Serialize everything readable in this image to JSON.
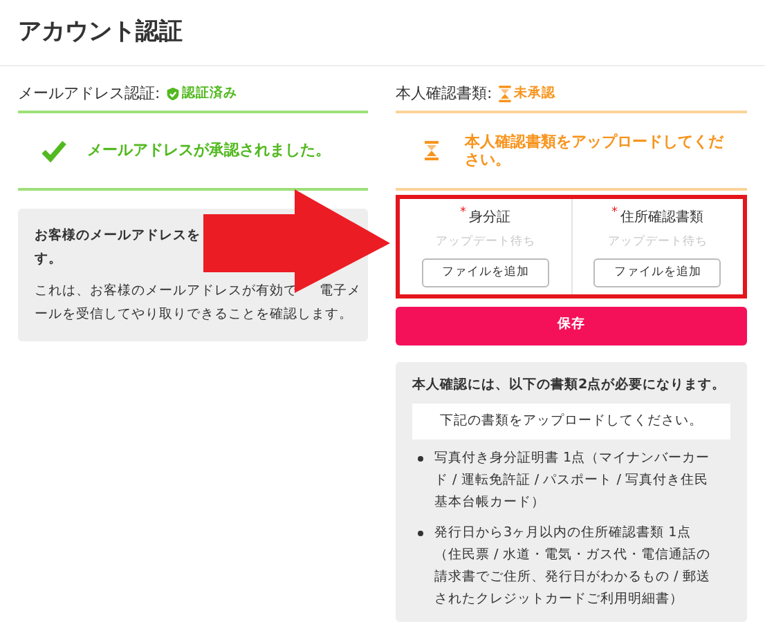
{
  "page_title": "アカウント認証",
  "email_verification": {
    "label": "メールアドレス認証:",
    "status": "認証済み",
    "verified": true,
    "message": "メールアドレスが承認されました。",
    "info_paragraphs": [
      [
        "お客様のメールアドレスを",
        "す。"
      ],
      [
        "これは、お客様のメールアドレスが有効で",
        "電子メ",
        "ールを受信してやり取りできることを確認します。"
      ]
    ]
  },
  "identity_documents": {
    "label": "本人確認書類:",
    "status": "未承認",
    "verified": false,
    "message": "本人確認書類をアップロードしてください。",
    "uploads": [
      {
        "required": true,
        "required_mark": "*",
        "label": "身分証",
        "status": "アップデート待ち",
        "button": "ファイルを追加"
      },
      {
        "required": true,
        "required_mark": "*",
        "label": "住所確認書類",
        "status": "アップデート待ち",
        "button": "ファイルを追加"
      }
    ],
    "save_button": "保存",
    "info": {
      "heading": "本人確認には、以下の書類2点が必要になります。",
      "notice": "下記の書類をアップロードしてください。",
      "items": [
        "写真付き身分証明書 1点（マイナンバーカード / 運転免許証 / パスポート / 写真付き住民基本台帳カード）",
        "発行日から3ヶ月以内の住所確認書類 1点（住民票 / 水道・電気・ガス代・電信通話の請求書でご住所、発行日がわかるもの / 郵送されたクレジットカードご利用明細書）"
      ]
    }
  },
  "annotation": {
    "kind": "arrow"
  }
}
